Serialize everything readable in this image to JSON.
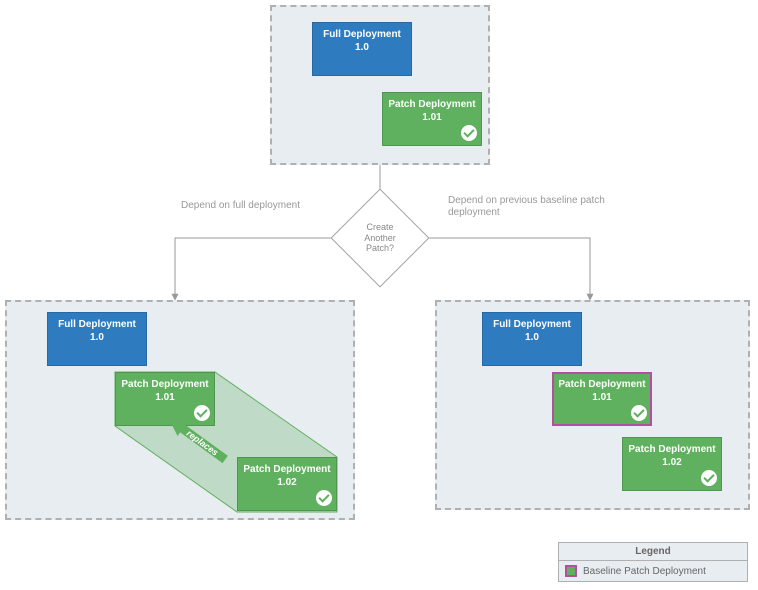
{
  "colors": {
    "full_deployment": "#2f7bbf",
    "patch_deployment": "#5fb05f",
    "baseline_outline": "#b24fa0",
    "panel_bg": "#e8edf2",
    "panel_border": "#b0b0b0"
  },
  "decision": {
    "text": "Create Another Patch?",
    "left_edge_label": "Depend on full deployment",
    "right_edge_label": "Depend on previous baseline patch deployment"
  },
  "top_panel": {
    "full": {
      "label": "Full Deployment",
      "version": "1.0"
    },
    "patch": {
      "label": "Patch Deployment",
      "version": "1.01"
    }
  },
  "left_panel": {
    "full": {
      "label": "Full Deployment",
      "version": "1.0"
    },
    "patch1": {
      "label": "Patch Deployment",
      "version": "1.01"
    },
    "patch2": {
      "label": "Patch Deployment",
      "version": "1.02"
    },
    "replace_label": "replaces"
  },
  "right_panel": {
    "full": {
      "label": "Full Deployment",
      "version": "1.0"
    },
    "patch1": {
      "label": "Patch Deployment",
      "version": "1.01",
      "baseline": true
    },
    "patch2": {
      "label": "Patch Deployment",
      "version": "1.02"
    }
  },
  "legend": {
    "title": "Legend",
    "item": "Baseline Patch Deployment"
  }
}
